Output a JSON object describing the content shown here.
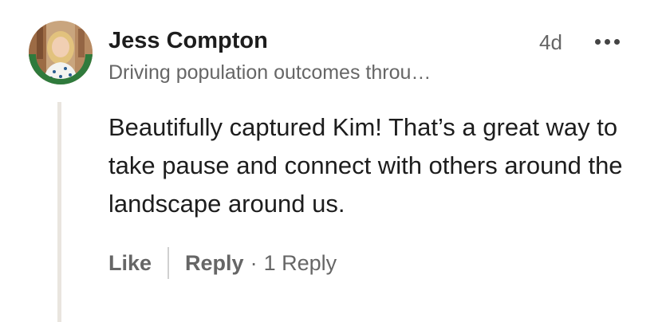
{
  "comment": {
    "author": {
      "name": "Jess Compton",
      "headline": "Driving population outcomes throu…",
      "avatar_badge": "#OPENTOWORK"
    },
    "timestamp": "4d",
    "more_icon": "ellipsis-icon",
    "body": "Beautifully captured Kim! That’s a great way to take pause and connect with others around the landscape around us.",
    "actions": {
      "like_label": "Like",
      "reply_label": "Reply",
      "separator": "·",
      "reply_count": "1 Reply"
    }
  },
  "colors": {
    "text_primary": "#1d1d1d",
    "text_secondary": "#666666",
    "open_to_work_green": "#2f7a3c",
    "thread_line": "#e9e5df"
  }
}
